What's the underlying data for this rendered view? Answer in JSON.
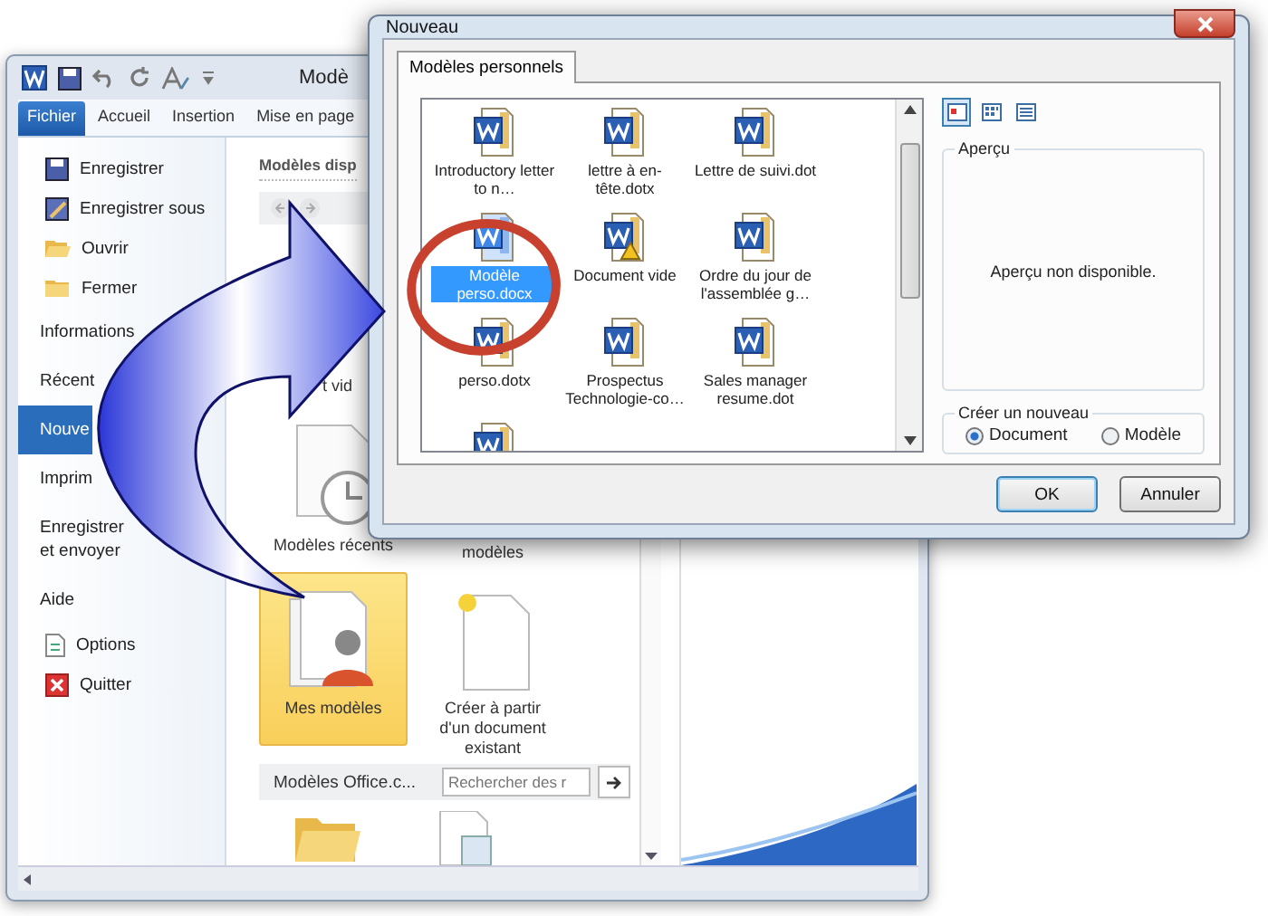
{
  "word_window": {
    "title": "Modè",
    "ribbon_tabs": [
      {
        "label": "Fichier",
        "selected": true
      },
      {
        "label": "Accueil",
        "selected": false
      },
      {
        "label": "Insertion",
        "selected": false
      },
      {
        "label": "Mise en page",
        "selected": false
      }
    ],
    "sidebar": [
      {
        "label": "Enregistrer",
        "kind": "command",
        "selected": false
      },
      {
        "label": "Enregistrer sous",
        "kind": "command",
        "selected": false
      },
      {
        "label": "Ouvrir",
        "kind": "command",
        "selected": false
      },
      {
        "label": "Fermer",
        "kind": "command",
        "selected": false
      },
      {
        "label": "Informations",
        "kind": "section",
        "selected": false
      },
      {
        "label": "Récent",
        "kind": "section",
        "selected": false
      },
      {
        "label": "Nouve",
        "kind": "section",
        "selected": true
      },
      {
        "label": "Imprim",
        "kind": "section",
        "selected": false
      },
      {
        "label": "Enregistrer et envoyer",
        "kind": "section",
        "selected": false
      },
      {
        "label": "Aide",
        "kind": "section",
        "selected": false
      },
      {
        "label": "Options",
        "kind": "command",
        "selected": false
      },
      {
        "label": "Quitter",
        "kind": "command",
        "selected": false
      }
    ],
    "heading": "Modèles disp",
    "tiles": [
      {
        "label": "t vid",
        "kind": "covered",
        "selected": false
      },
      {
        "label": "Modèles récents",
        "kind": "recent",
        "selected": false
      },
      {
        "label": "modèles",
        "kind": "covered",
        "selected": false
      },
      {
        "label": "Mes modèles",
        "kind": "personal",
        "selected": true
      },
      {
        "label": "Créer à partir d'un document existant",
        "kind": "from-existing",
        "selected": false
      }
    ],
    "office_section": {
      "label": "Modèles Office.c...",
      "search_placeholder": "Rechercher des r"
    }
  },
  "dialog": {
    "title": "Nouveau",
    "tabs": [
      {
        "label": "Modèles personnels",
        "selected": true
      }
    ],
    "view_buttons": [
      {
        "selected": true
      },
      {
        "selected": false
      },
      {
        "selected": false
      }
    ],
    "templates": [
      {
        "label": "Introductory letter to n…",
        "kind": "document",
        "selected": false
      },
      {
        "label": "lettre à en-tête.dotx",
        "kind": "document",
        "selected": false
      },
      {
        "label": "Lettre de suivi.dot",
        "kind": "document",
        "selected": false
      },
      {
        "label": "Modèle perso.docx",
        "kind": "document",
        "selected": true
      },
      {
        "label": "Document vide",
        "kind": "warning",
        "selected": false
      },
      {
        "label": "Ordre du jour de l'assemblée g…",
        "kind": "document",
        "selected": false
      },
      {
        "label": "perso.dotx",
        "kind": "document",
        "selected": false
      },
      {
        "label": "Prospectus Technologie-co…",
        "kind": "document",
        "selected": false
      },
      {
        "label": "Sales manager resume.dot",
        "kind": "document",
        "selected": false
      },
      {
        "kind": "document",
        "selected": false
      }
    ],
    "preview": {
      "title": "Aperçu",
      "message": "Aperçu non disponible."
    },
    "create": {
      "title": "Créer un nouveau",
      "options": [
        {
          "label": "Document",
          "selected": true
        },
        {
          "label": "Modèle",
          "selected": false
        }
      ]
    },
    "buttons": [
      {
        "label": "OK",
        "kind": "default"
      },
      {
        "label": "Annuler",
        "kind": "normal"
      }
    ]
  }
}
